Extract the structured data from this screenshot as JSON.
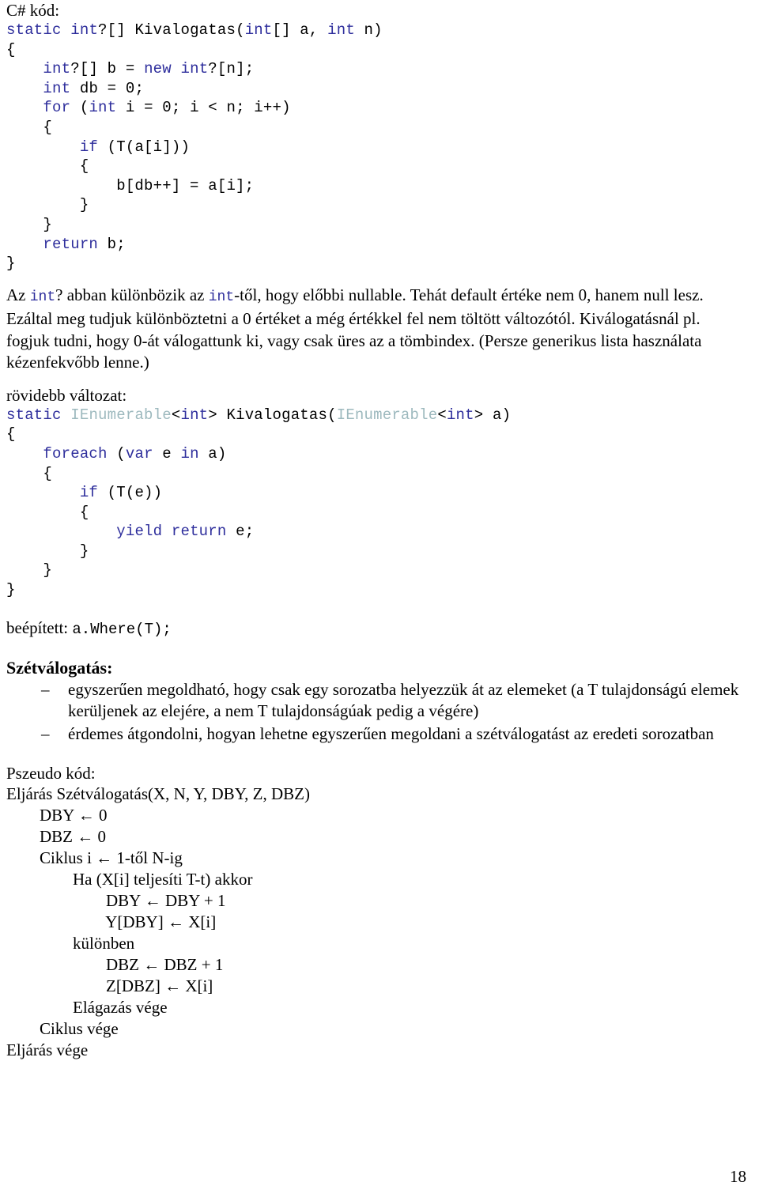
{
  "document": {
    "language": "hu",
    "page_number": "18",
    "colors": {
      "keyword_blue": "#2e2e9c",
      "type_teal": "#9db9be",
      "text_black": "#000000",
      "background": "#ffffff"
    }
  },
  "sections": {
    "csharp_label": "C# kód:",
    "code_block_1": {
      "lines": [
        [
          {
            "t": "static",
            "c": "kw"
          },
          {
            "t": " ",
            "c": "pl"
          },
          {
            "t": "int",
            "c": "kw"
          },
          {
            "t": "?[] Kivalogatas(",
            "c": "pl"
          },
          {
            "t": "int",
            "c": "kw"
          },
          {
            "t": "[] a, ",
            "c": "pl"
          },
          {
            "t": "int",
            "c": "kw"
          },
          {
            "t": " n)",
            "c": "pl"
          }
        ],
        [
          {
            "t": "{",
            "c": "pl"
          }
        ],
        [
          {
            "t": "    ",
            "c": "pl"
          },
          {
            "t": "int",
            "c": "kw"
          },
          {
            "t": "?[] b = ",
            "c": "pl"
          },
          {
            "t": "new",
            "c": "kw"
          },
          {
            "t": " ",
            "c": "pl"
          },
          {
            "t": "int",
            "c": "kw"
          },
          {
            "t": "?[n];",
            "c": "pl"
          }
        ],
        [
          {
            "t": "    ",
            "c": "pl"
          },
          {
            "t": "int",
            "c": "kw"
          },
          {
            "t": " db = 0;",
            "c": "pl"
          }
        ],
        [
          {
            "t": "    ",
            "c": "pl"
          },
          {
            "t": "for",
            "c": "kw"
          },
          {
            "t": " (",
            "c": "pl"
          },
          {
            "t": "int",
            "c": "kw"
          },
          {
            "t": " i = 0; i < n; i++)",
            "c": "pl"
          }
        ],
        [
          {
            "t": "    {",
            "c": "pl"
          }
        ],
        [
          {
            "t": "        ",
            "c": "pl"
          },
          {
            "t": "if",
            "c": "kw"
          },
          {
            "t": " (T(a[i]))",
            "c": "pl"
          }
        ],
        [
          {
            "t": "        {",
            "c": "pl"
          }
        ],
        [
          {
            "t": "            b[db++] = a[i];",
            "c": "pl"
          }
        ],
        [
          {
            "t": "        }",
            "c": "pl"
          }
        ],
        [
          {
            "t": "    }",
            "c": "pl"
          }
        ],
        [
          {
            "t": "    ",
            "c": "pl"
          },
          {
            "t": "return",
            "c": "kw"
          },
          {
            "t": " b;",
            "c": "pl"
          }
        ],
        [
          {
            "t": "}",
            "c": "pl"
          }
        ]
      ]
    },
    "explanation_paragraph": {
      "parts": [
        {
          "t": "Az ",
          "c": "plain"
        },
        {
          "t": "int",
          "c": "code"
        },
        {
          "t": "? abban különbözik az ",
          "c": "plain"
        },
        {
          "t": "int",
          "c": "code"
        },
        {
          "t": "-től, hogy előbbi nullable. Tehát default értéke nem 0, hanem null lesz. Ezáltal meg tudjuk különböztetni a 0 értéket a még értékkel fel nem töltött változótól. Kiválogatásnál pl. fogjuk tudni, hogy 0-át válogattunk ki, vagy csak üres az a tömbindex. (Persze generikus lista használata kézenfekvőbb lenne.)",
          "c": "plain"
        }
      ]
    },
    "shorter_label": "rövidebb változat:",
    "code_block_2": {
      "lines": [
        [
          {
            "t": "static",
            "c": "kw"
          },
          {
            "t": " ",
            "c": "pl"
          },
          {
            "t": "IEnumerable",
            "c": "type"
          },
          {
            "t": "<",
            "c": "pl"
          },
          {
            "t": "int",
            "c": "kw"
          },
          {
            "t": "> Kivalogatas(",
            "c": "pl"
          },
          {
            "t": "IEnumerable",
            "c": "type"
          },
          {
            "t": "<",
            "c": "pl"
          },
          {
            "t": "int",
            "c": "kw"
          },
          {
            "t": "> a)",
            "c": "pl"
          }
        ],
        [
          {
            "t": "{",
            "c": "pl"
          }
        ],
        [
          {
            "t": "    ",
            "c": "pl"
          },
          {
            "t": "foreach",
            "c": "kw"
          },
          {
            "t": " (",
            "c": "pl"
          },
          {
            "t": "var",
            "c": "kw"
          },
          {
            "t": " e ",
            "c": "pl"
          },
          {
            "t": "in",
            "c": "kw"
          },
          {
            "t": " a)",
            "c": "pl"
          }
        ],
        [
          {
            "t": "    {",
            "c": "pl"
          }
        ],
        [
          {
            "t": "        ",
            "c": "pl"
          },
          {
            "t": "if",
            "c": "kw"
          },
          {
            "t": " (T(e))",
            "c": "pl"
          }
        ],
        [
          {
            "t": "        {",
            "c": "pl"
          }
        ],
        [
          {
            "t": "            ",
            "c": "pl"
          },
          {
            "t": "yield",
            "c": "kw"
          },
          {
            "t": " ",
            "c": "pl"
          },
          {
            "t": "return",
            "c": "kw"
          },
          {
            "t": " e;",
            "c": "pl"
          }
        ],
        [
          {
            "t": "        }",
            "c": "pl"
          }
        ],
        [
          {
            "t": "    }",
            "c": "pl"
          }
        ],
        [
          {
            "t": "}",
            "c": "pl"
          }
        ]
      ]
    },
    "builtin_line": {
      "label": "beépített: ",
      "code": "a.Where(T);"
    },
    "partition_heading": "Szétválogatás:",
    "partition_bullets": [
      {
        "marker": "–",
        "text": "egyszerűen megoldható, hogy csak egy sorozatba helyezzük át az elemeket (a T tulajdonságú elemek kerüljenek az elejére, a nem T tulajdonságúak pedig a végére)"
      },
      {
        "marker": "–",
        "text": "érdemes átgondolni, hogyan lehetne egyszerűen megoldani a szétválogatást az eredeti sorozatban"
      }
    ],
    "pseudocode_label": "Pszeudo kód:",
    "pseudocode_lines": [
      "Eljárás Szétválogatás(X, N, Y, DBY, Z, DBZ)",
      "        DBY ← 0",
      "        DBZ ← 0",
      "        Ciklus i ← 1-től N-ig",
      "                Ha (X[i] teljesíti T-t) akkor",
      "                        DBY ← DBY + 1",
      "                        Y[DBY] ← X[i]",
      "                különben",
      "                        DBZ ← DBZ + 1",
      "                        Z[DBZ] ← X[i]",
      "                Elágazás vége",
      "        Ciklus vége",
      "Eljárás vége"
    ]
  }
}
